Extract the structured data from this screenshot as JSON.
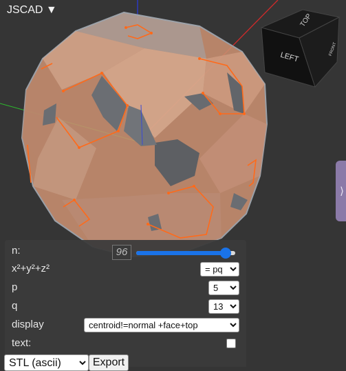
{
  "app": {
    "title": "JSCAD ▼"
  },
  "view_cube": {
    "top_label": "TOP",
    "left_label": "LEFT",
    "front_label": "FRONT"
  },
  "side_panel": {
    "toggle_glyph": "⟩"
  },
  "params": {
    "n": {
      "label": "n:",
      "value": "96",
      "slider_fraction": 0.9
    },
    "sphere": {
      "label": "x²+y²+z²",
      "selected": "= pq"
    },
    "p": {
      "label": "p",
      "selected": "5"
    },
    "q": {
      "label": "q",
      "selected": "13"
    },
    "display": {
      "label": "display",
      "selected": "centroid!=normal +face+top"
    },
    "text": {
      "label": "text:",
      "checked": false
    }
  },
  "export": {
    "format_selected": "STL (ascii)",
    "button_label": "Export"
  },
  "colors": {
    "background": "#353535",
    "shell": "#d6a489",
    "edges": "#ff6a1a",
    "accent": "#1a73e8",
    "panel_tab": "#8b7aa8"
  }
}
